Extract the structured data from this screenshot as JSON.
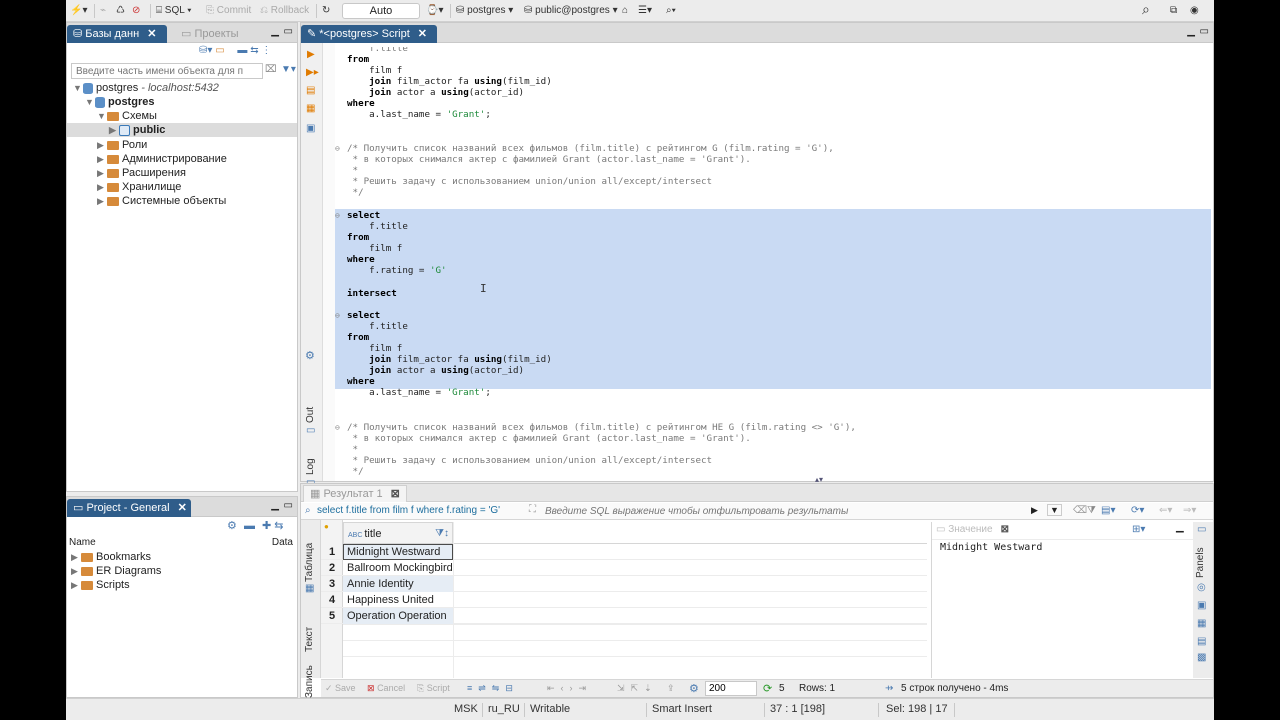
{
  "toolbar": {
    "sql": "SQL",
    "commit": "Commit",
    "rollback": "Rollback",
    "mode": "Auto",
    "datasource": "postgres",
    "schema": "public@postgres"
  },
  "db_nav": {
    "tab_active": "Базы данн",
    "tab_inactive": "Проекты",
    "filter_placeholder": "Введите часть имени объекта для п",
    "tree": [
      {
        "label": "postgres",
        "suffix": " - localhost:5432"
      },
      {
        "label": "postgres"
      },
      {
        "label": "Схемы"
      },
      {
        "label": "public"
      },
      {
        "label": "Роли"
      },
      {
        "label": "Администрирование"
      },
      {
        "label": "Расширения"
      },
      {
        "label": "Хранилище"
      },
      {
        "label": "Системные объекты"
      }
    ]
  },
  "project": {
    "tab": "Project - General",
    "col_name": "Name",
    "col_data": "Data",
    "items": [
      "Bookmarks",
      "ER Diagrams",
      "Scripts"
    ]
  },
  "editor": {
    "tab": "*<postgres> Script",
    "side_out": "Out",
    "side_log": "Log"
  },
  "results": {
    "tab": "Результат 1",
    "query": "select f.title from film f where f.rating = 'G'",
    "filter_placeholder": "Введите SQL выражение чтобы отфильтровать результаты",
    "column": "title",
    "rows": [
      "Midnight Westward",
      "Ballroom Mockingbird",
      "Annie Identity",
      "Happiness United",
      "Operation Operation"
    ],
    "row_numbers": [
      "1",
      "2",
      "3",
      "4",
      "5"
    ],
    "value_panel_title": "Значение",
    "value_text": "Midnight Westward",
    "side_table": "Таблица",
    "side_text": "Текст",
    "side_record": "Запись",
    "panels": "Panels",
    "bottom": {
      "save": "Save",
      "cancel": "Cancel",
      "script": "Script",
      "fetch": "200",
      "count": "5",
      "rows": "Rows: 1",
      "status": "5 строк получено - 4ms"
    }
  },
  "statusbar": {
    "tz": "MSK",
    "locale": "ru_RU",
    "mode": "Writable",
    "insert": "Smart Insert",
    "pos": "37 : 1 [198]",
    "sel": "Sel: 198 | 17"
  },
  "colors": {
    "selection": "#c9daf3",
    "tab_active": "#2f5d8a",
    "string": "#1d8a3a",
    "comment": "#7a7a7a"
  }
}
